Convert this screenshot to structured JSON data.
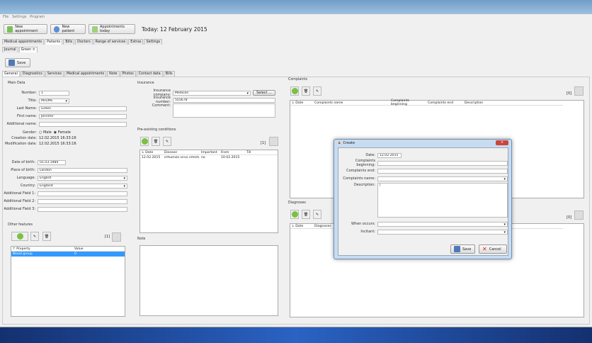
{
  "menu": [
    "File",
    "Settings",
    "Program"
  ],
  "toolbar": {
    "new_appointment": "New appointment",
    "new_patient": "New patient",
    "appointments_today": "Appointments today",
    "today": "Today: 12 February 2015"
  },
  "main_tabs": [
    "Medical appointments",
    "Patients",
    "Bills",
    "Doctors",
    "Range of services",
    "Extras",
    "Settings"
  ],
  "sub_tabs": {
    "journal": "Journal",
    "green": "Green",
    "close": "×"
  },
  "save_label": "Save",
  "patient_tabs": [
    "General",
    "Diagnostics",
    "Services",
    "Medical appointments",
    "Note",
    "Photos",
    "Contact data",
    "Bills"
  ],
  "main_data": {
    "title": "Main Data",
    "number_label": "Number:",
    "number": "1",
    "title_label": "Title:",
    "title_value": "Mrs/Ms",
    "last_name_label": "Last Name:",
    "last_name": "Green",
    "first_name_label": "First name:",
    "first_name": "Jennifer",
    "additional_name_label": "Additional name:",
    "additional_name": "",
    "gender_label": "Gender:",
    "male": "Male",
    "female": "Female",
    "creation_label": "Creation date:",
    "creation": "12.02.2015   16:33:16",
    "modification_label": "Modification date:",
    "modification": "12.02.2015   16:33:16",
    "dob_label": "Date of birth:",
    "dob": "01.03.1984",
    "pob_label": "Place of birth:",
    "pob": "London",
    "language_label": "Language:",
    "language": "English",
    "country_label": "Country:",
    "country": "England",
    "af1_label": "Additional Field 1:",
    "af2_label": "Additional Field 2:",
    "af3_label": "Additional Field 3:"
  },
  "other_features": {
    "title": "Other features",
    "count": "[1]",
    "headers": [
      "↑ Property",
      "Value"
    ],
    "rows": [
      [
        "Blood group",
        "0"
      ]
    ]
  },
  "insurance": {
    "title": "Insurance",
    "company_label": "Insurance company:",
    "company": "Medicon",
    "select": "Select ...",
    "number_label": "Insurance number:",
    "number": "555678",
    "comment_label": "Comment:"
  },
  "preexisting": {
    "title": "Pre-existing conditions",
    "count": "[1]",
    "headers": [
      "↓ Date",
      "Disease",
      "Important",
      "From",
      "Till"
    ],
    "rows": [
      [
        "12.02.2015",
        "influenza virus infecti...",
        "no",
        "10.02.2015",
        ""
      ]
    ]
  },
  "note": {
    "title": "Note"
  },
  "complaints": {
    "title": "Complaints",
    "count": "[0]",
    "headers": [
      "↓ Date",
      "Complaints name",
      "Complaints beginning",
      "Complaints end",
      "Description"
    ]
  },
  "diagnoses": {
    "title": "Diagnoses",
    "count": "[0]",
    "headers": [
      "↓ Date",
      "Diagnoses"
    ]
  },
  "dialog": {
    "title": "Create",
    "date_label": "Date:",
    "date": "12.02.2015",
    "beginning_label": "Complaints beginning:",
    "end_label": "Complaints end:",
    "name_label": "Complaints name:",
    "description_label": "Description:",
    "when_label": "When occurs:",
    "incitant_label": "Incitant:",
    "save": "Save",
    "cancel": "Cancel"
  }
}
